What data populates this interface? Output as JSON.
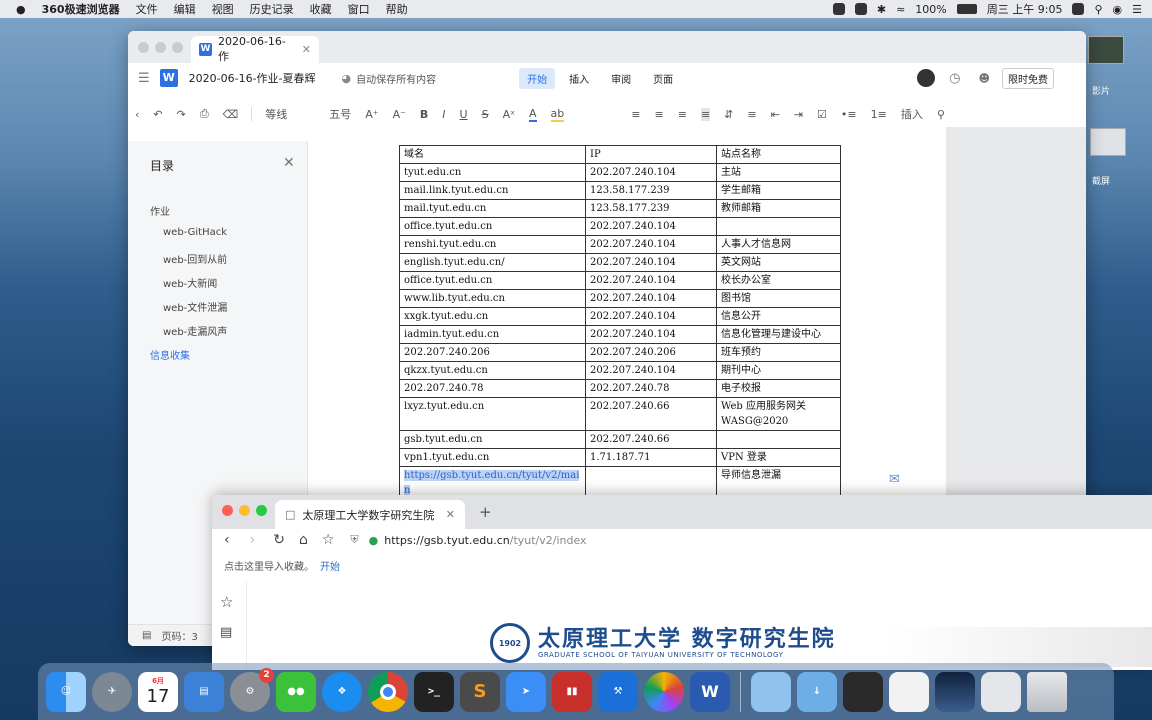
{
  "menubar": {
    "app": "360极速浏览器",
    "items": [
      "文件",
      "编辑",
      "视图",
      "历史记录",
      "收藏",
      "窗口",
      "帮助"
    ],
    "battery": "100%",
    "clock": "周三 上午 9:05"
  },
  "desktop": {
    "label1": "影片",
    "label2": "截屏"
  },
  "wps": {
    "tab_title": "2020-06-16-作",
    "doc_title": "2020-06-16-作业-夏春辉",
    "autosave": "自动保存所有内容",
    "ribbon": [
      "开始",
      "插入",
      "审阅",
      "页面"
    ],
    "free_label": "限时免费",
    "toolbar": {
      "font": "等线",
      "size": "五号",
      "insert": "插入"
    },
    "outline": {
      "title": "目录",
      "items": [
        "作业",
        "web-GitHack",
        "web-回到从前",
        "web-大新闻",
        "web-文件泄漏",
        "web-走漏风声",
        "信息收集"
      ]
    },
    "page_label": "页码：3",
    "table": {
      "headers": [
        "域名",
        "IP",
        "站点名称"
      ],
      "rows": [
        [
          "tyut.edu.cn",
          "202.207.240.104",
          "主站"
        ],
        [
          "mail.link.tyut.edu.cn",
          "123.58.177.239",
          "学生邮箱"
        ],
        [
          "mail.tyut.edu.cn",
          "123.58.177.239",
          "教师邮箱"
        ],
        [
          "office.tyut.edu.cn",
          "202.207.240.104",
          ""
        ],
        [
          "renshi.tyut.edu.cn",
          "202.207.240.104",
          "人事人才信息网"
        ],
        [
          "english.tyut.edu.cn/",
          "202.207.240.104",
          "英文网站"
        ],
        [
          "office.tyut.edu.cn",
          "202.207.240.104",
          "校长办公室"
        ],
        [
          "www.lib.tyut.edu.cn",
          "202.207.240.104",
          "图书馆"
        ],
        [
          "xxgk.tyut.edu.cn",
          "202.207.240.104",
          "信息公开"
        ],
        [
          "iadmin.tyut.edu.cn",
          "202.207.240.104",
          "信息化管理与建设中心"
        ],
        [
          "202.207.240.206",
          "202.207.240.206",
          "班车预约"
        ],
        [
          "qkzx.tyut.edu.cn",
          "202.207.240.104",
          "期刊中心"
        ],
        [
          "202.207.240.78",
          "202.207.240.78",
          "电子校报"
        ],
        [
          "lxyz.tyut.edu.cn",
          "202.207.240.66",
          "Web 应用服务网关 WASG@2020"
        ],
        [
          "gsb.tyut.edu.cn",
          "202.207.240.66",
          ""
        ],
        [
          "vpn1.tyut.edu.cn",
          "1.71.187.71",
          "VPN 登录"
        ],
        [
          "https://gsb.tyut.edu.cn/tyut/v2/main",
          "",
          "导师信息泄漏"
        ]
      ]
    }
  },
  "browser": {
    "tab_title": "太原理工大学数字研究生院",
    "url_host": "https://gsb.tyut.edu.cn",
    "url_path": "/tyut/v2/index",
    "bookmark_hint": "点击这里导入收藏。",
    "bookmark_link": "开始",
    "logo_title": "太原理工大学 数字研究生院",
    "logo_sub": "GRADUATE SCHOOL OF TAIYUAN UNIVERSITY OF TECHNOLOGY"
  },
  "dock": {
    "calendar_month": "6月",
    "calendar_day": "17",
    "badge": "2"
  }
}
